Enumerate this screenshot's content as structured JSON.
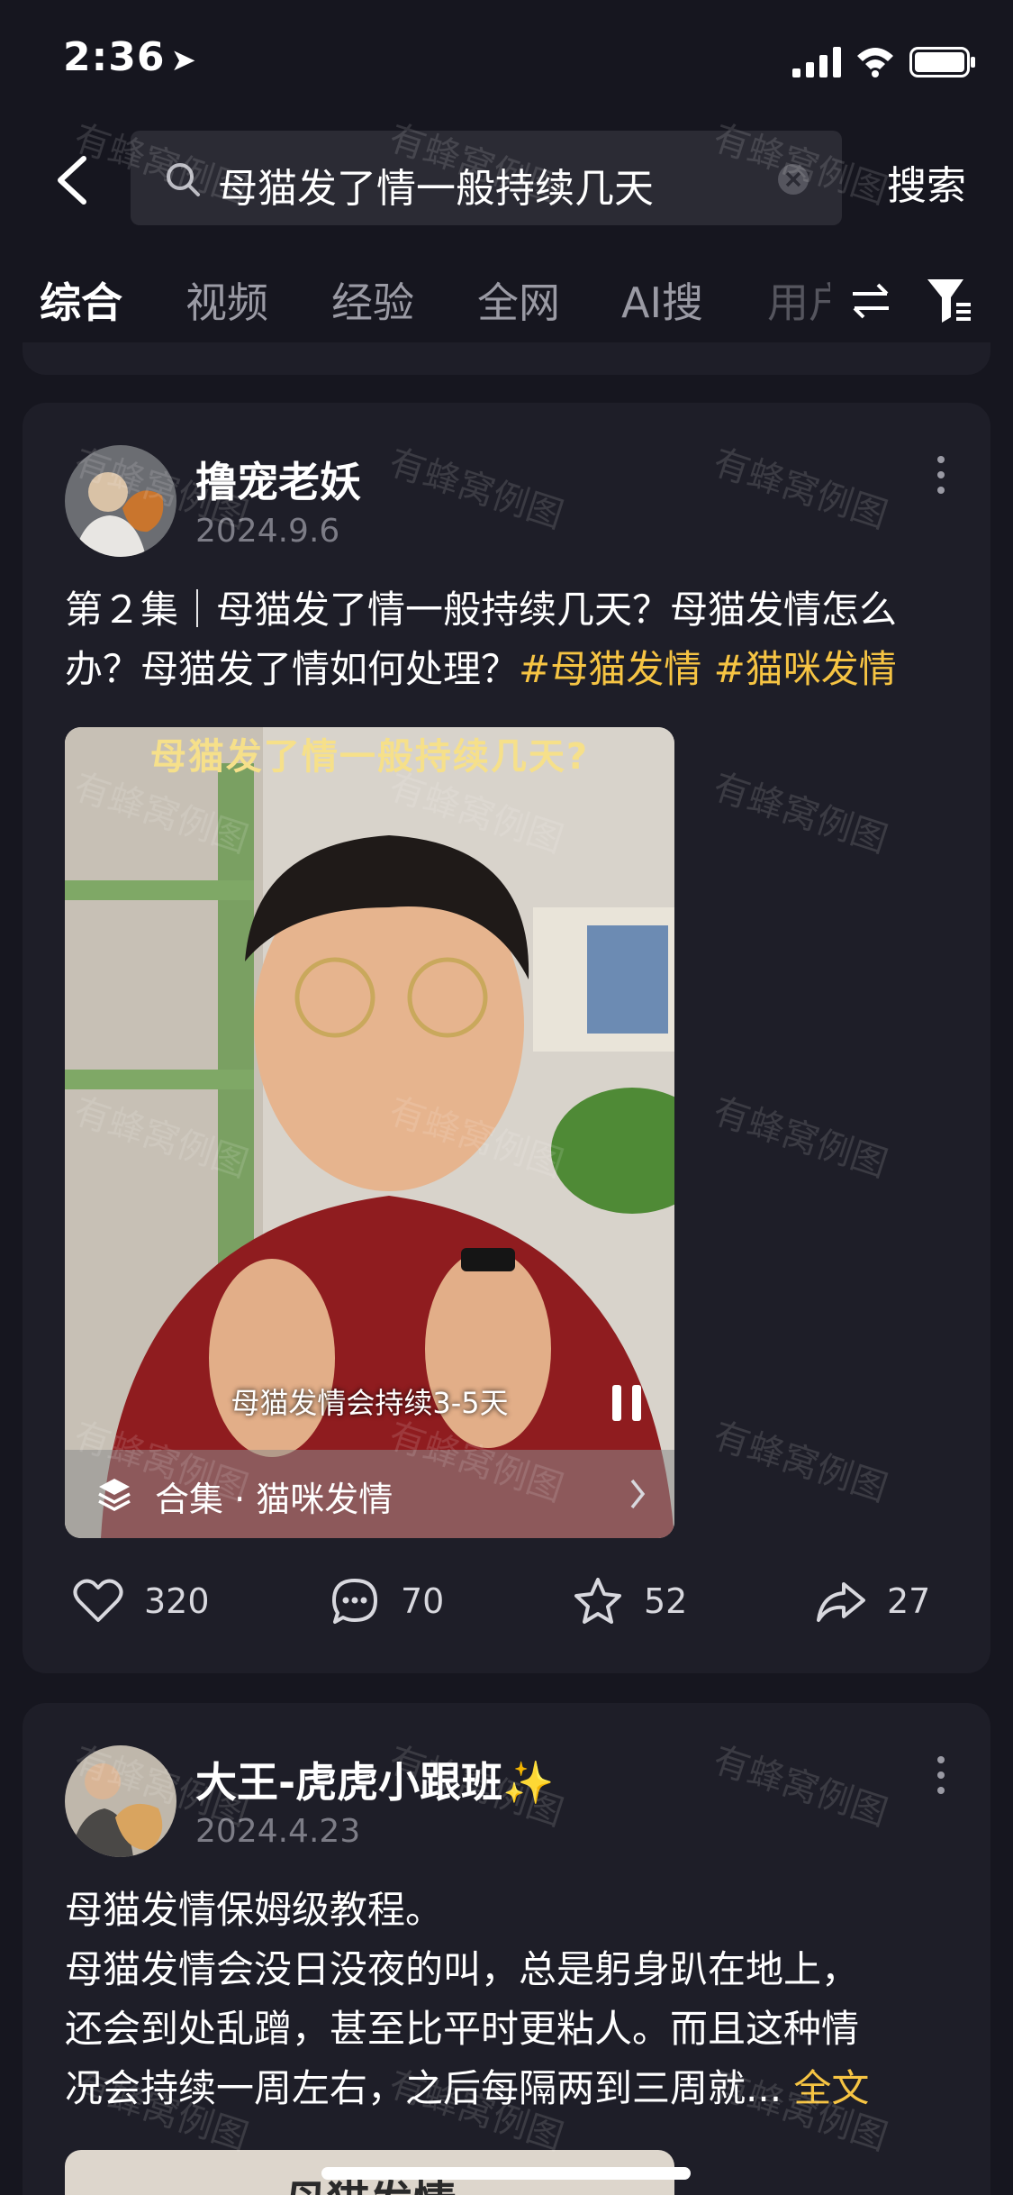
{
  "status": {
    "time": "2:36"
  },
  "search": {
    "query": "母猫发了情一般持续几天",
    "button": "搜索"
  },
  "tabs": [
    {
      "label": "综合"
    },
    {
      "label": "视频"
    },
    {
      "label": "经验"
    },
    {
      "label": "全网"
    },
    {
      "label": "AI搜"
    },
    {
      "label": "用户"
    }
  ],
  "posts": [
    {
      "author": "撸宠老妖",
      "date": "2024.9.6",
      "text": "第２集｜母猫发了情一般持续几天？母猫发情怎么办？母猫发了情如何处理？",
      "tags": [
        "#母猫发情",
        "#猫咪发情"
      ],
      "video": {
        "title": "母猫发了情一般持续几天?",
        "subtitle": "母猫发情会持续3-5天",
        "collection": "合集 · 猫咪发情"
      },
      "likes": "320",
      "comments": "70",
      "favorites": "52",
      "shares": "27"
    },
    {
      "author": "大王-虎虎小跟班✨",
      "date": "2024.4.23",
      "line1": "母猫发情保姆级教程。",
      "line2": "母猫发情会没日没夜的叫，总是躬身趴在地上，",
      "line3": "还会到处乱蹭，甚至比平时更粘人。而且这种情",
      "line4": "况会持续一周左右，之后每隔两到三周就...",
      "fulltext": "全文",
      "video_title_partial": "母猫发情"
    }
  ],
  "watermark": "有蜂窝例图",
  "colors": {
    "background": "#16161f",
    "card": "#1e1e28",
    "accent": "#f6c443"
  }
}
